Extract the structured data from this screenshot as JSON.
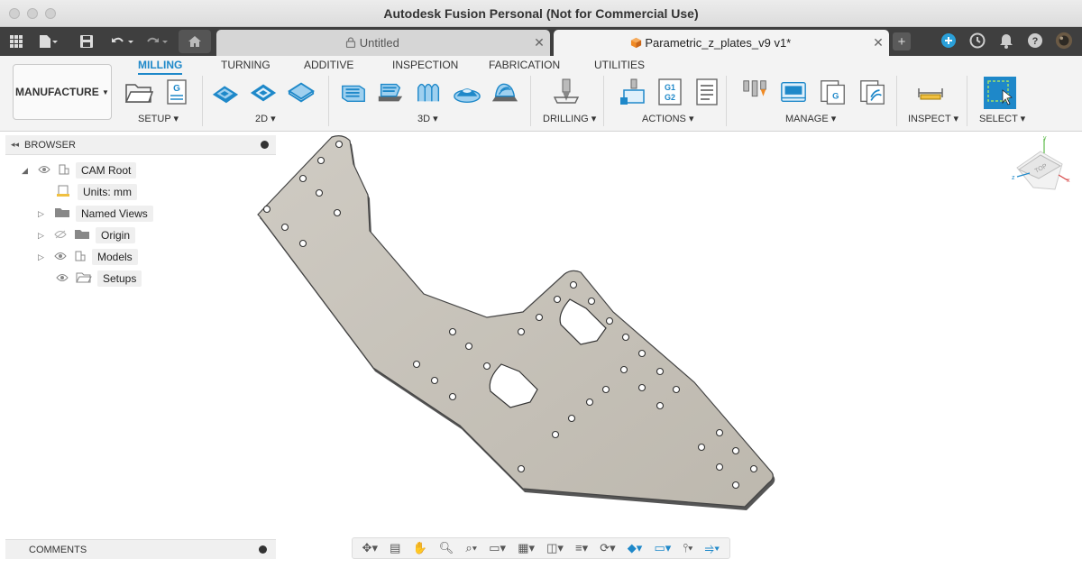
{
  "window": {
    "title": "Autodesk Fusion Personal (Not for Commercial Use)"
  },
  "tabs": [
    {
      "label": "Untitled",
      "icon": "lock-icon"
    },
    {
      "label": "Parametric_z_plates_v9 v1*",
      "icon": "cube-icon"
    }
  ],
  "ribbon": {
    "workspace": "MANUFACTURE",
    "tabs": [
      "MILLING",
      "TURNING",
      "ADDITIVE",
      "INSPECTION",
      "FABRICATION",
      "UTILITIES"
    ],
    "active_tab": "MILLING",
    "groups": [
      "SETUP",
      "2D",
      "3D",
      "DRILLING",
      "ACTIONS",
      "MANAGE",
      "INSPECT",
      "SELECT"
    ],
    "g1g2": "G1 G2",
    "g_label": "G"
  },
  "browser": {
    "title": "BROWSER",
    "items": [
      "CAM Root",
      "Units: mm",
      "Named Views",
      "Origin",
      "Models",
      "Setups"
    ]
  },
  "comments": {
    "title": "COMMENTS"
  },
  "viewcube": {
    "face": "TOP",
    "axis_x": "x",
    "axis_y": "y",
    "axis_z": "z"
  },
  "colors": {
    "accent": "#1e88c9",
    "plate": "#c9c4bb",
    "tabbar": "#3f3f3f"
  }
}
